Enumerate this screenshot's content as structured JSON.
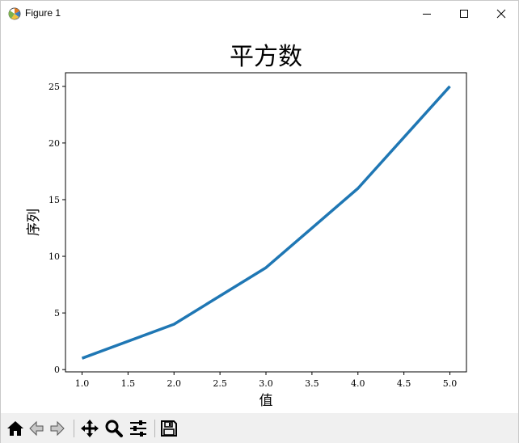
{
  "window": {
    "title": "Figure 1"
  },
  "chart_data": {
    "type": "line",
    "title": "平方数",
    "xlabel": "值",
    "ylabel": "序列",
    "x": [
      1,
      2,
      3,
      4,
      5
    ],
    "y": [
      1,
      4,
      9,
      16,
      25
    ],
    "xlim": [
      0.82,
      5.18
    ],
    "ylim": [
      -0.2,
      26.2
    ],
    "xticks": [
      "1.0",
      "1.5",
      "2.0",
      "2.5",
      "3.0",
      "3.5",
      "4.0",
      "4.5",
      "5.0"
    ],
    "yticks": [
      "0",
      "5",
      "10",
      "15",
      "20",
      "25"
    ],
    "line_color": "#1f77b4",
    "grid": false
  },
  "toolbar": {
    "buttons": [
      "home-icon",
      "back-icon",
      "forward-icon",
      "pan-icon",
      "zoom-icon",
      "configure-subplots-icon",
      "save-icon"
    ]
  }
}
